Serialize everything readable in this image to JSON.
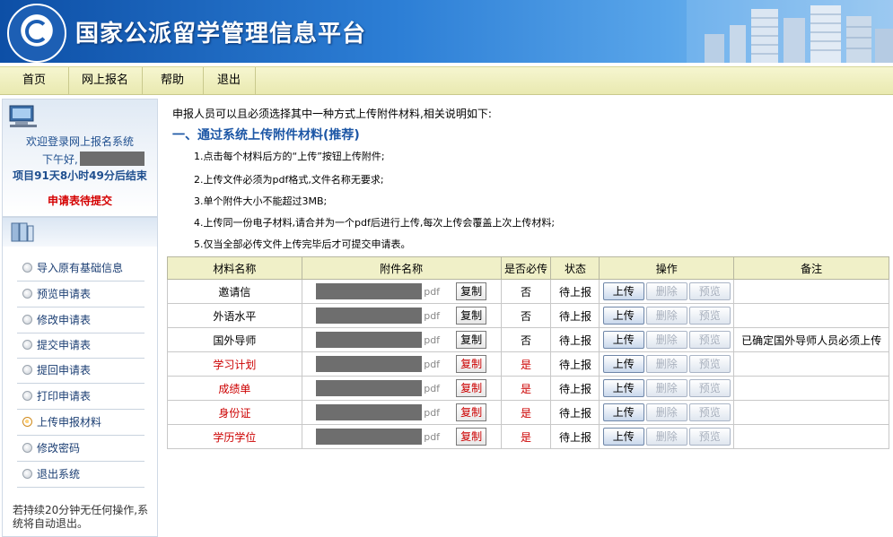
{
  "header": {
    "title": "国家公派留学管理信息平台"
  },
  "nav": [
    {
      "label": "首页"
    },
    {
      "label": "网上报名"
    },
    {
      "label": "帮助"
    },
    {
      "label": "退出"
    }
  ],
  "welcome": {
    "greeting": "欢迎登录网上报名系统",
    "time_label": "下午好,",
    "countdown": "项目91天8小时49分后结束",
    "status": "申请表待提交"
  },
  "sidebar": {
    "items": [
      {
        "label": "导入原有基础信息",
        "active": false
      },
      {
        "label": "预览申请表",
        "active": false
      },
      {
        "label": "修改申请表",
        "active": false
      },
      {
        "label": "提交申请表",
        "active": false
      },
      {
        "label": "提回申请表",
        "active": false
      },
      {
        "label": "打印申请表",
        "active": false
      },
      {
        "label": "上传申报材料",
        "active": true
      },
      {
        "label": "修改密码",
        "active": false
      },
      {
        "label": "退出系统",
        "active": false
      }
    ],
    "note": "若持续20分钟无任何操作,系统将自动退出。"
  },
  "main": {
    "intro": "申报人员可以且必须选择其中一种方式上传附件材料,相关说明如下:",
    "section_title": "一、通过系统上传附件材料(推荐)",
    "rules": [
      "1.点击每个材料后方的“上传”按钮上传附件;",
      "2.上传文件必须为pdf格式,文件名称无要求;",
      "3.单个附件大小不能超过3MB;",
      "4.上传同一份电子材料,请合并为一个pdf后进行上传,每次上传会覆盖上次上传材料;",
      "5.仅当全部必传文件上传完毕后才可提交申请表。"
    ],
    "table": {
      "headers": [
        "材料名称",
        "附件名称",
        "是否必传",
        "状态",
        "操作",
        "备注"
      ],
      "buttons": {
        "copy": "复制",
        "upload": "上传",
        "delete": "删除",
        "preview": "预览"
      },
      "pdf_suffix": "pdf",
      "rows": [
        {
          "name": "邀请信",
          "required": "否",
          "status": "待上报",
          "note": "",
          "mandatory": false
        },
        {
          "name": "外语水平",
          "required": "否",
          "status": "待上报",
          "note": "",
          "mandatory": false
        },
        {
          "name": "国外导师",
          "required": "否",
          "status": "待上报",
          "note": "已确定国外导师人员必须上传",
          "mandatory": false
        },
        {
          "name": "学习计划",
          "required": "是",
          "status": "待上报",
          "note": "",
          "mandatory": true
        },
        {
          "name": "成绩单",
          "required": "是",
          "status": "待上报",
          "note": "",
          "mandatory": true
        },
        {
          "name": "身份证",
          "required": "是",
          "status": "待上报",
          "note": "",
          "mandatory": true
        },
        {
          "name": "学历学位",
          "required": "是",
          "status": "待上报",
          "note": "",
          "mandatory": true
        }
      ]
    }
  },
  "colors": {
    "brand_blue": "#1c56a5",
    "required_red": "#cc0000",
    "nav_bg": "#eeeebb"
  }
}
